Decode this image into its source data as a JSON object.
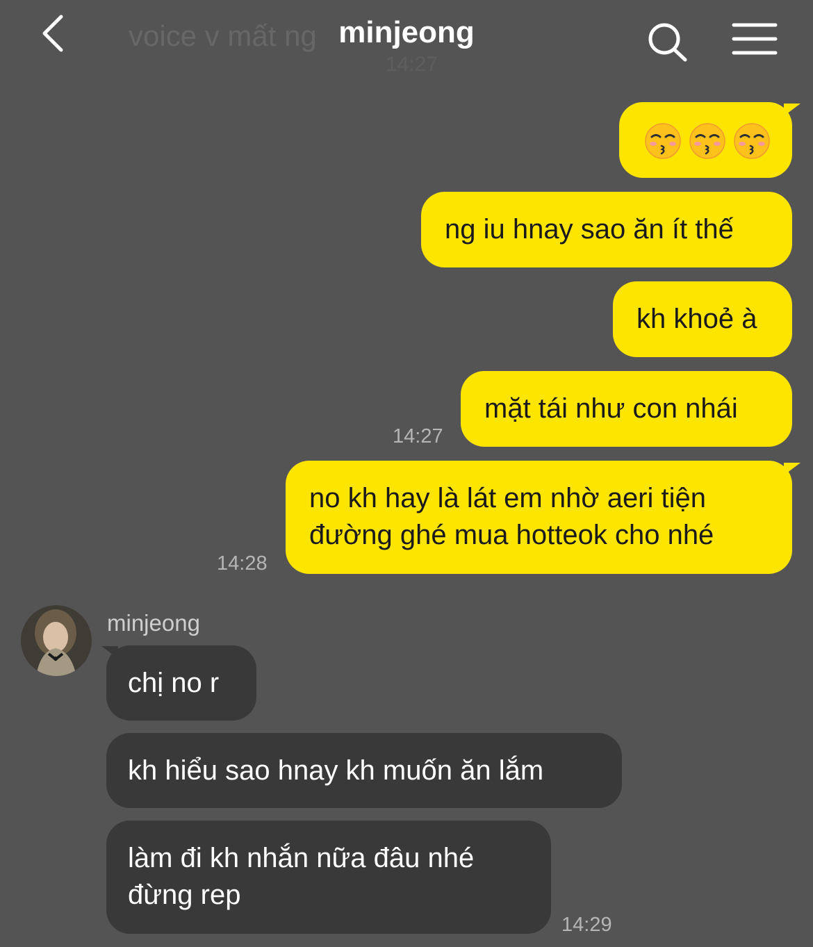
{
  "header": {
    "title": "minjeong",
    "ghost_preview": "voice v mất ng",
    "ghost_time": "14:27",
    "back_icon": "chevron-left-icon",
    "search_icon": "search-icon",
    "menu_icon": "menu-icon"
  },
  "colors": {
    "background": "#555455",
    "outgoing_bubble": "#fee500",
    "incoming_bubble": "#3a393a"
  },
  "outgoing": [
    {
      "emoji": [
        "kissing-face-with-closed-eyes",
        "kissing-face-with-closed-eyes",
        "kissing-face-with-closed-eyes"
      ]
    },
    {
      "text": "ng iu hnay sao ăn ít thế"
    },
    {
      "text": "kh khoẻ à"
    },
    {
      "text": "mặt tái như con nhái",
      "time": "14:27"
    },
    {
      "line1": "no kh hay là lát em nhờ aeri tiện",
      "line2": "đường ghé mua hotteok cho nhé",
      "time": "14:28"
    }
  ],
  "incoming": {
    "sender": "minjeong",
    "messages": [
      {
        "text": "chị no r"
      },
      {
        "text": "kh hiểu sao hnay kh muốn ăn lắm"
      },
      {
        "line1": "làm đi kh nhắn nữa đâu nhé",
        "line2": "đừng rep",
        "time": "14:29"
      }
    ]
  }
}
